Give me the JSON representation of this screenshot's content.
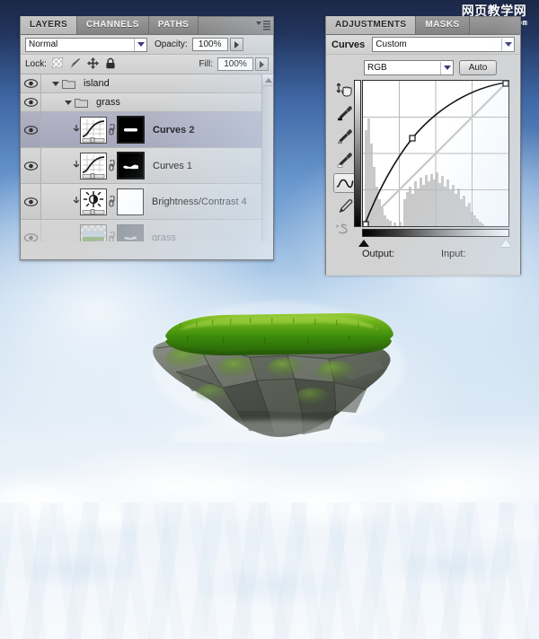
{
  "watermark": {
    "cn_text": "网页教学网",
    "url_text": "www.webjx.com"
  },
  "layers_panel": {
    "tabs": [
      {
        "label": "LAYERS",
        "active": true
      },
      {
        "label": "CHANNELS",
        "active": false
      },
      {
        "label": "PATHS",
        "active": false
      }
    ],
    "menu_icon": "panel-menu-icon",
    "blend_mode": "Normal",
    "opacity_label": "Opacity:",
    "opacity_value": "100%",
    "lock_label": "Lock:",
    "lock_icons": [
      "transparency-lock-icon",
      "brush-lock-icon",
      "move-lock-icon",
      "all-lock-icon"
    ],
    "fill_label": "Fill:",
    "fill_value": "100%",
    "layers": [
      {
        "name": "island",
        "type": "group",
        "indent": 1,
        "expanded": true,
        "visible": true,
        "selected": false,
        "faded": false
      },
      {
        "name": "grass",
        "type": "group",
        "indent": 2,
        "expanded": true,
        "visible": true,
        "selected": false,
        "faded": false
      },
      {
        "name": "Curves 2",
        "type": "adjustment-curves",
        "indent": 3,
        "clipped": true,
        "visible": true,
        "selected": true,
        "faded": false,
        "mask": "black-with-white-dash",
        "bold": true
      },
      {
        "name": "Curves 1",
        "type": "adjustment-curves",
        "indent": 3,
        "clipped": true,
        "visible": true,
        "selected": false,
        "faded": false,
        "mask": "black-with-white-curve",
        "bold": false
      },
      {
        "name": "Brightness/Contrast 4",
        "type": "adjustment-brightness-contrast",
        "indent": 3,
        "clipped": true,
        "visible": true,
        "selected": false,
        "faded": false,
        "mask": "white",
        "bold": false
      },
      {
        "name": "grass",
        "type": "pixel",
        "indent": 3,
        "clipped": false,
        "visible": true,
        "selected": false,
        "faded": true,
        "mask": "dark-with-shape",
        "bold": false,
        "underline": true
      }
    ],
    "scrollbar": {
      "up_arrow": "scroll-up-icon"
    }
  },
  "adjustments_panel": {
    "tabs": [
      {
        "label": "ADJUSTMENTS",
        "active": true
      },
      {
        "label": "MASKS",
        "active": false
      }
    ],
    "title": "Curves",
    "preset_value": "Custom",
    "channel_value": "RGB",
    "auto_label": "Auto",
    "tools": [
      "targeted-adjustment-icon",
      "eyedropper-black-icon",
      "eyedropper-gray-icon",
      "eyedropper-white-icon",
      "curve-point-tool-icon",
      "pencil-draw-tool-icon",
      "smooth-curve-icon"
    ],
    "selected_tool": "curve-point-tool-icon",
    "output_label": "Output:",
    "input_label": "Input:",
    "output_value": "",
    "input_value": "",
    "curve": {
      "grid_divisions": 4,
      "points": [
        {
          "input": 0,
          "output": 0
        },
        {
          "input": 85,
          "output": 153
        },
        {
          "input": 255,
          "output": 255
        }
      ],
      "baseline": "diagonal",
      "histogram_visible": true
    }
  },
  "canvas": {
    "subject": "floating-grass-island",
    "sky_top_color": "#1b2746",
    "sky_mid_color": "#6c9ad0",
    "cloud_color": "#f2f6fb",
    "grass_color": "#4f9b14",
    "rock_color": "#6b6f63"
  }
}
